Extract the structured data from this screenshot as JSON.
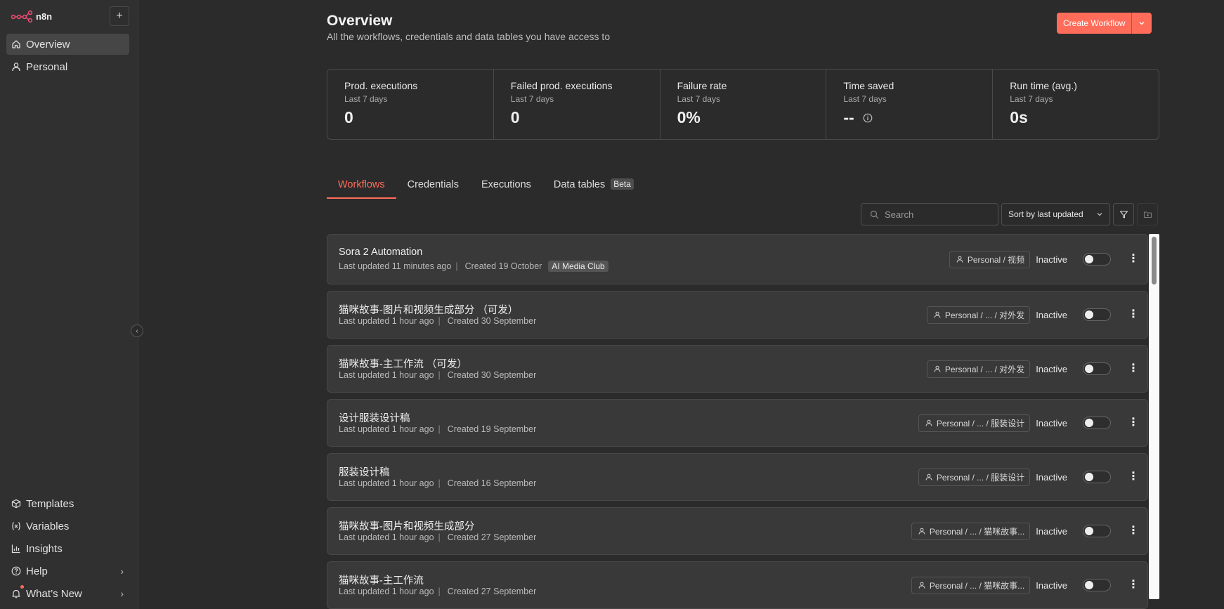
{
  "app": {
    "name": "n8n"
  },
  "sidebar": {
    "add_label": "+",
    "top": [
      {
        "label": "Overview",
        "icon": "home-icon",
        "active": true
      },
      {
        "label": "Personal",
        "icon": "user-icon",
        "active": false
      }
    ],
    "bottom": [
      {
        "label": "Templates",
        "icon": "box-icon"
      },
      {
        "label": "Variables",
        "icon": "variable-icon"
      },
      {
        "label": "Insights",
        "icon": "chart-icon"
      },
      {
        "label": "Help",
        "icon": "help-icon"
      },
      {
        "label": "What’s New",
        "icon": "bell-icon"
      }
    ]
  },
  "header": {
    "title": "Overview",
    "subtitle": "All the workflows, credentials and data tables you have access to",
    "create_label": "Create Workflow"
  },
  "stats": [
    {
      "label": "Prod. executions",
      "sub": "Last 7 days",
      "value": "0"
    },
    {
      "label": "Failed prod. executions",
      "sub": "Last 7 days",
      "value": "0"
    },
    {
      "label": "Failure rate",
      "sub": "Last 7 days",
      "value": "0%"
    },
    {
      "label": "Time saved",
      "sub": "Last 7 days",
      "value": "--"
    },
    {
      "label": "Run time (avg.)",
      "sub": "Last 7 days",
      "value": "0s"
    }
  ],
  "tabs": [
    {
      "label": "Workflows",
      "active": true
    },
    {
      "label": "Credentials"
    },
    {
      "label": "Executions"
    },
    {
      "label": "Data tables",
      "badge": "Beta"
    }
  ],
  "toolbar": {
    "search_placeholder": "Search",
    "sort_label": "Sort by last updated"
  },
  "workflows": [
    {
      "name": "Sora 2 Automation",
      "updated": "Last updated 11 minutes ago",
      "created": "Created 19 October",
      "tag": "AI Media Club",
      "project": "Personal / 视频",
      "status": "Inactive"
    },
    {
      "name": "猫咪故事-图片和视频生成部分 （可发）",
      "updated": "Last updated 1 hour ago",
      "created": "Created 30 September",
      "project": "Personal / ... / 对外发",
      "status": "Inactive"
    },
    {
      "name": "猫咪故事-主工作流 （可发）",
      "updated": "Last updated 1 hour ago",
      "created": "Created 30 September",
      "project": "Personal / ... / 对外发",
      "status": "Inactive"
    },
    {
      "name": "设计服装设计稿",
      "updated": "Last updated 1 hour ago",
      "created": "Created 19 September",
      "project": "Personal / ... / 服装设计",
      "status": "Inactive"
    },
    {
      "name": "服装设计稿",
      "updated": "Last updated 1 hour ago",
      "created": "Created 16 September",
      "project": "Personal / ... / 服装设计",
      "status": "Inactive"
    },
    {
      "name": "猫咪故事-图片和视频生成部分",
      "updated": "Last updated 1 hour ago",
      "created": "Created 27 September",
      "project": "Personal / ... / 猫咪故事...",
      "status": "Inactive"
    },
    {
      "name": "猫咪故事-主工作流",
      "updated": "Last updated 1 hour ago",
      "created": "Created 27 September",
      "project": "Personal / ... / 猫咪故事...",
      "status": "Inactive"
    }
  ],
  "colors": {
    "accent": "#ff6d5a",
    "background": "#2b2b2b",
    "card": "#393939"
  }
}
